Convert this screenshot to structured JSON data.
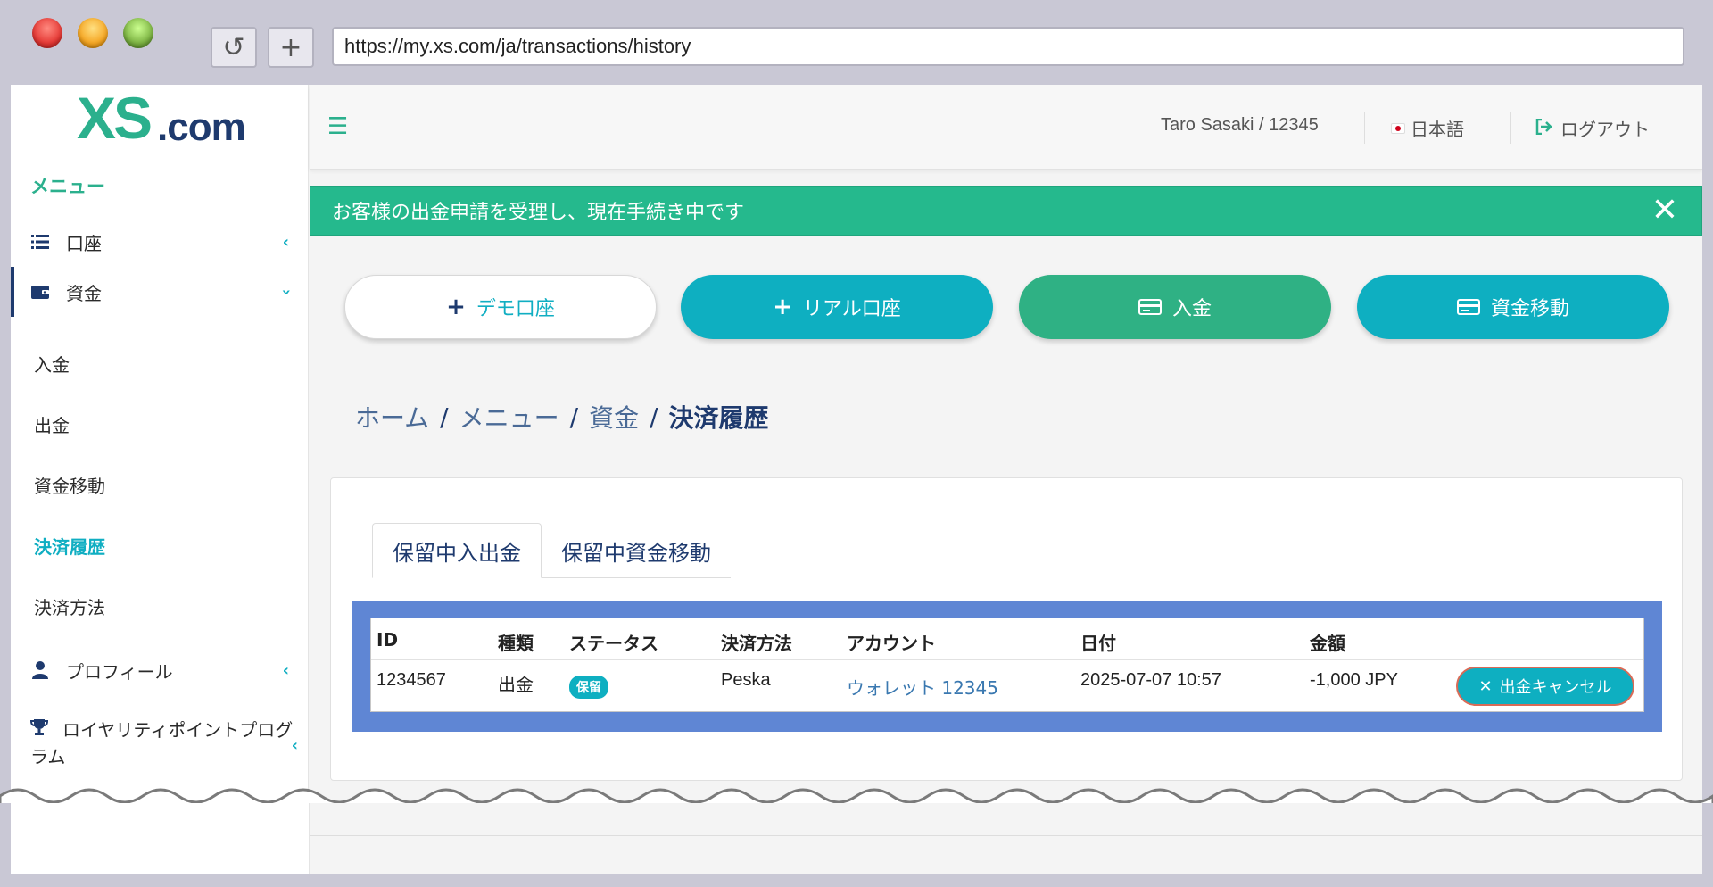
{
  "browser": {
    "url": "https://my.xs.com/ja/transactions/history",
    "reload_icon": "↺",
    "newtab_icon": "+"
  },
  "logo": {
    "xs": "XS",
    "com": ".com"
  },
  "sidebar": {
    "menu_title": "メニュー",
    "items": [
      {
        "label": "口座",
        "icon": "list-icon"
      },
      {
        "label": "資金",
        "icon": "wallet-icon"
      }
    ],
    "sub_items": [
      {
        "label": "入金"
      },
      {
        "label": "出金"
      },
      {
        "label": "資金移動"
      },
      {
        "label": "決済履歴"
      },
      {
        "label": "決済方法"
      }
    ],
    "profile": {
      "label": "プロフィール",
      "icon": "user-icon"
    },
    "loyalty": {
      "label": "ロイヤリティポイントプログラム",
      "icon": "trophy-icon"
    }
  },
  "header": {
    "user": "Taro Sasaki / 12345",
    "language": "日本語",
    "logout": "ログアウト"
  },
  "alert": {
    "message": "お客様の出金申請を受理し、現在手続き中です",
    "close": "✕"
  },
  "actions": {
    "demo": "デモ口座",
    "real": "リアル口座",
    "deposit": "入金",
    "transfer": "資金移動"
  },
  "breadcrumb": {
    "home": "ホーム",
    "menu": "メニュー",
    "funds": "資金",
    "current": "決済履歴",
    "sep": "/"
  },
  "tabs": [
    {
      "label": "保留中入出金"
    },
    {
      "label": "保留中資金移動"
    }
  ],
  "table": {
    "headers": {
      "id": "ID",
      "type": "種類",
      "status": "ステータス",
      "method": "決済方法",
      "account": "アカウント",
      "date": "日付",
      "amount": "金額"
    },
    "rows": [
      {
        "id": "1234567",
        "type": "出金",
        "status": "保留",
        "method": "Peska",
        "account": "ウォレット 12345",
        "date": "2025-07-07 10:57",
        "amount": "-1,000 JPY",
        "action": "出金キャンセル"
      }
    ]
  },
  "colors": {
    "brand_green": "#2bb08d",
    "brand_navy": "#1e3a6e",
    "accent_teal": "#0eafc1",
    "alert_green": "#25b98d",
    "highlight_blue": "#5f86d4"
  }
}
